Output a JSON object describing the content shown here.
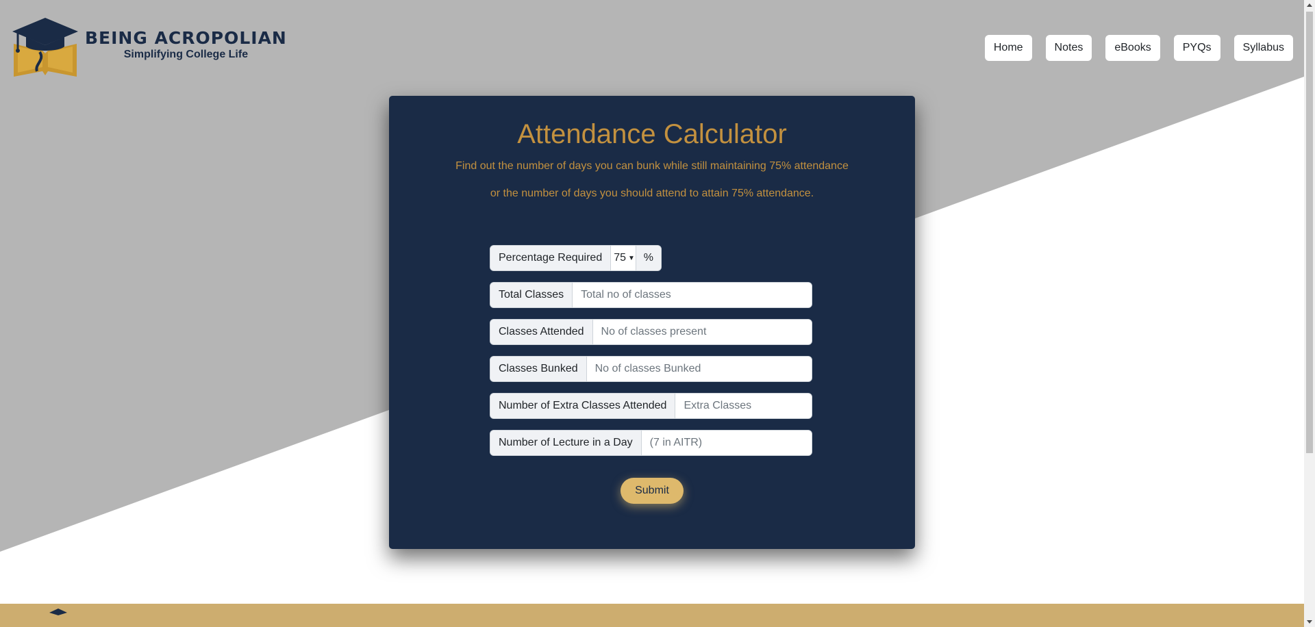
{
  "brand": {
    "title": "BEING ACROPOLIAN",
    "subtitle": "Simplifying College Life"
  },
  "nav": {
    "items": [
      "Home",
      "Notes",
      "eBooks",
      "PYQs",
      "Syllabus"
    ]
  },
  "calculator": {
    "title": "Attendance Calculator",
    "subtitle_line1": "Find out the number of days you can bunk while still maintaining 75% attendance",
    "subtitle_line2": "or the number of days you should attend to attain 75% attendance.",
    "percentage": {
      "label": "Percentage Required",
      "selected": "75",
      "suffix": "%"
    },
    "fields": {
      "total": {
        "label": "Total Classes",
        "placeholder": "Total no of classes"
      },
      "attended": {
        "label": "Classes Attended",
        "placeholder": "No of classes present"
      },
      "bunked": {
        "label": "Classes Bunked",
        "placeholder": "No of classes Bunked"
      },
      "extra": {
        "label": "Number of Extra Classes Attended",
        "placeholder": "Extra Classes"
      },
      "lecture": {
        "label": "Number of Lecture in a Day",
        "placeholder": "(7 in AITR)"
      }
    },
    "submit_label": "Submit"
  },
  "colors": {
    "navy": "#1a2b46",
    "gold": "#c3913f",
    "button_gold": "#deb96c",
    "grey_band": "#b5b5b5",
    "footer": "#cdad6f"
  }
}
